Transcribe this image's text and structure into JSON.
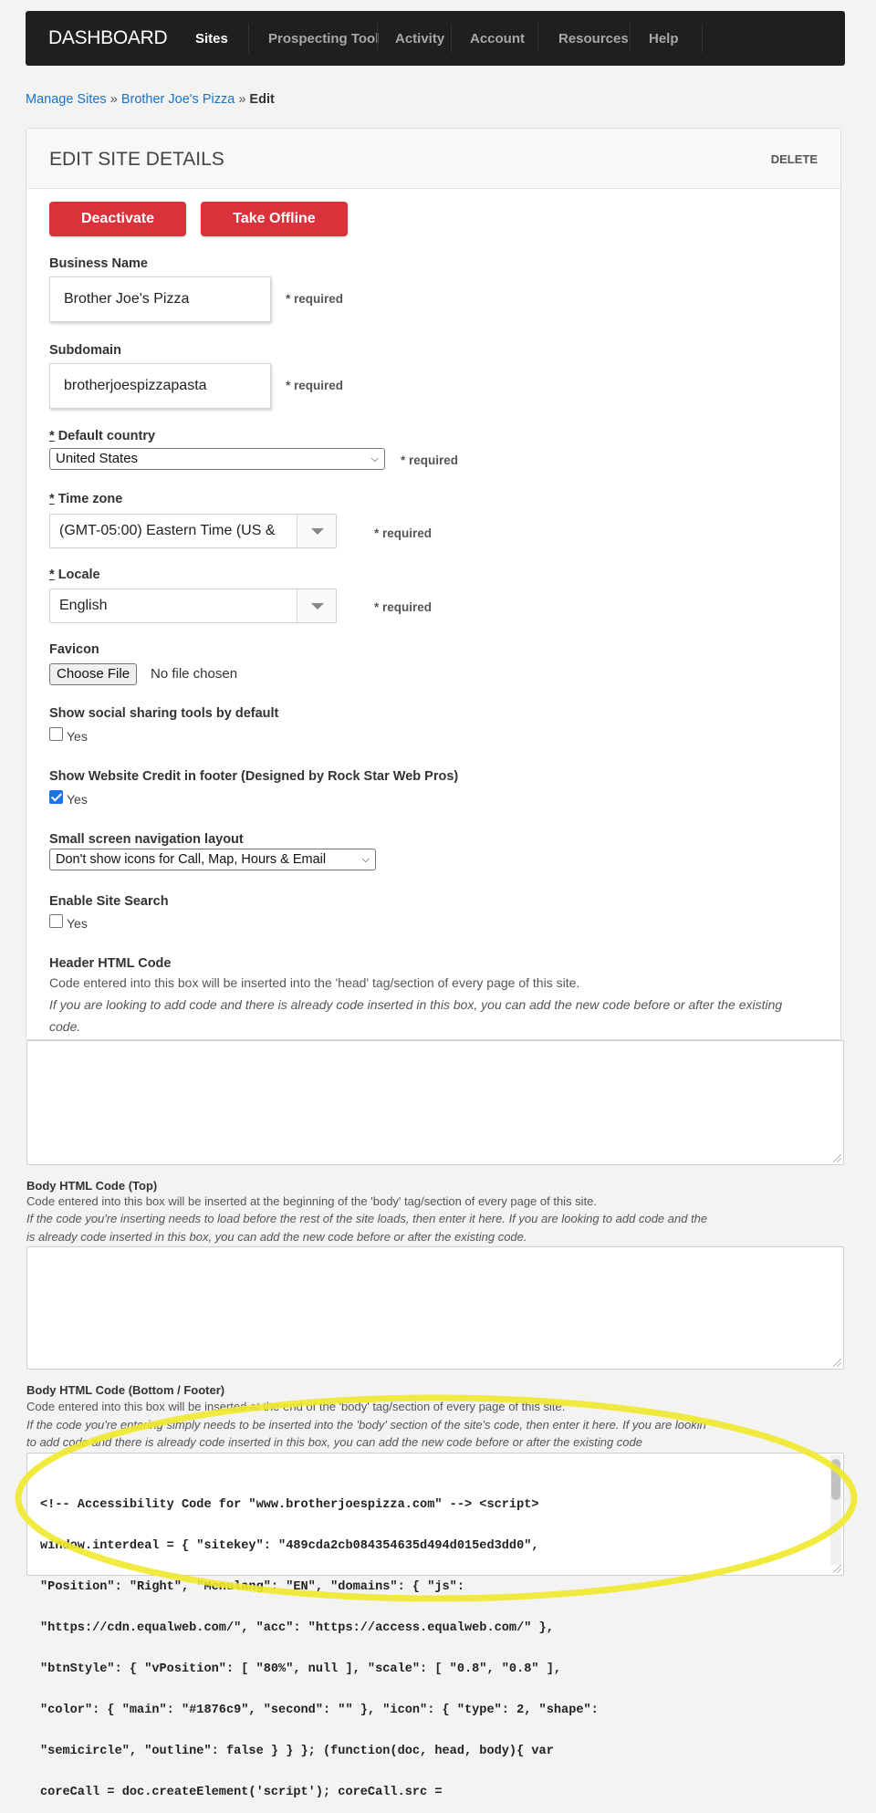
{
  "nav": {
    "brand": "DASHBOARD",
    "items": [
      "Sites",
      "Prospecting Tool",
      "Activity",
      "Account",
      "Resources",
      "Help"
    ],
    "active": "Sites"
  },
  "breadcrumb": {
    "manage_sites": "Manage Sites",
    "site": "Brother Joe's Pizza",
    "separator": "»",
    "current": "Edit"
  },
  "panel": {
    "title": "EDIT SITE DETAILS",
    "delete": "DELETE"
  },
  "buttons": {
    "deactivate": "Deactivate",
    "take_offline": "Take Offline"
  },
  "form": {
    "required_text": "* required",
    "business_name": {
      "label": "Business Name",
      "value": "Brother Joe's Pizza"
    },
    "subdomain": {
      "label": "Subdomain",
      "value": "brotherjoespizzapasta"
    },
    "default_country": {
      "label_marker": "*",
      "label": "Default country",
      "value": "United States"
    },
    "time_zone": {
      "label_marker": "*",
      "label": "Time zone",
      "value": "(GMT-05:00) Eastern Time (US &"
    },
    "locale": {
      "label_marker": "*",
      "label": "Locale",
      "value": "English"
    },
    "favicon": {
      "label": "Favicon",
      "button": "Choose File",
      "status": "No file chosen"
    },
    "social_sharing": {
      "label": "Show social sharing tools by default",
      "option": "Yes",
      "checked": false
    },
    "website_credit": {
      "label": "Show Website Credit in footer (Designed by Rock Star Web Pros)",
      "option": "Yes",
      "checked": true
    },
    "small_screen_nav": {
      "label": "Small screen navigation layout",
      "value": "Don't show icons for Call, Map, Hours & Email"
    },
    "site_search": {
      "label": "Enable Site Search",
      "option": "Yes",
      "checked": false
    },
    "header_html": {
      "label": "Header HTML Code",
      "desc": "Code entered into this box will be inserted into the 'head' tag/section of every page of this site.",
      "note_line1": "If you are looking to add code and there is already code inserted in this box, you can add the new code before or after the existing",
      "note_line2": "code."
    },
    "body_top_html": {
      "label": "Body HTML Code (Top)",
      "desc": "Code entered into this box will be inserted at the beginning of the 'body' tag/section of every page of this site.",
      "note_line1": "If the code you're inserting needs to load before the rest of the site loads, then enter it here. If you are looking to add code and the",
      "note_line2": "is already code inserted in this box, you can add the new code before or after the existing code."
    },
    "body_bottom_html": {
      "label": "Body HTML Code (Bottom / Footer)",
      "desc": "Code entered into this box will be inserted at the end of the 'body' tag/section of every page of this site.",
      "note_line1": "If the code you're entering simply needs to be inserted into the 'body' section of the site's code, then enter it here. If you are lookin",
      "note_line2": "to add code and there is already code inserted in this box, you can add the new code before or after the existing code",
      "code_lines": [
        "<!-- Accessibility Code for \"www.brotherjoespizza.com\" --> <script>",
        "window.interdeal = { \"sitekey\": \"489cda2cb084354635d494d015ed3dd0\",",
        "\"Position\": \"Right\", \"Menulang\": \"EN\", \"domains\": { \"js\":",
        "\"https://cdn.equalweb.com/\", \"acc\": \"https://access.equalweb.com/\" },",
        "\"btnStyle\": { \"vPosition\": [ \"80%\", null ], \"scale\": [ \"0.8\", \"0.8\" ],",
        "\"color\": { \"main\": \"#1876c9\", \"second\": \"\" }, \"icon\": { \"type\": 2, \"shape\":",
        "\"semicircle\", \"outline\": false } } }; (function(doc, head, body){ var",
        "coreCall = doc.createElement('script'); coreCall.src ="
      ]
    }
  },
  "colors": {
    "nav_bg": "#1f1f1f",
    "link": "#1a73c9",
    "button_red": "#d9323b",
    "highlight_ellipse": "#f0e82a"
  }
}
